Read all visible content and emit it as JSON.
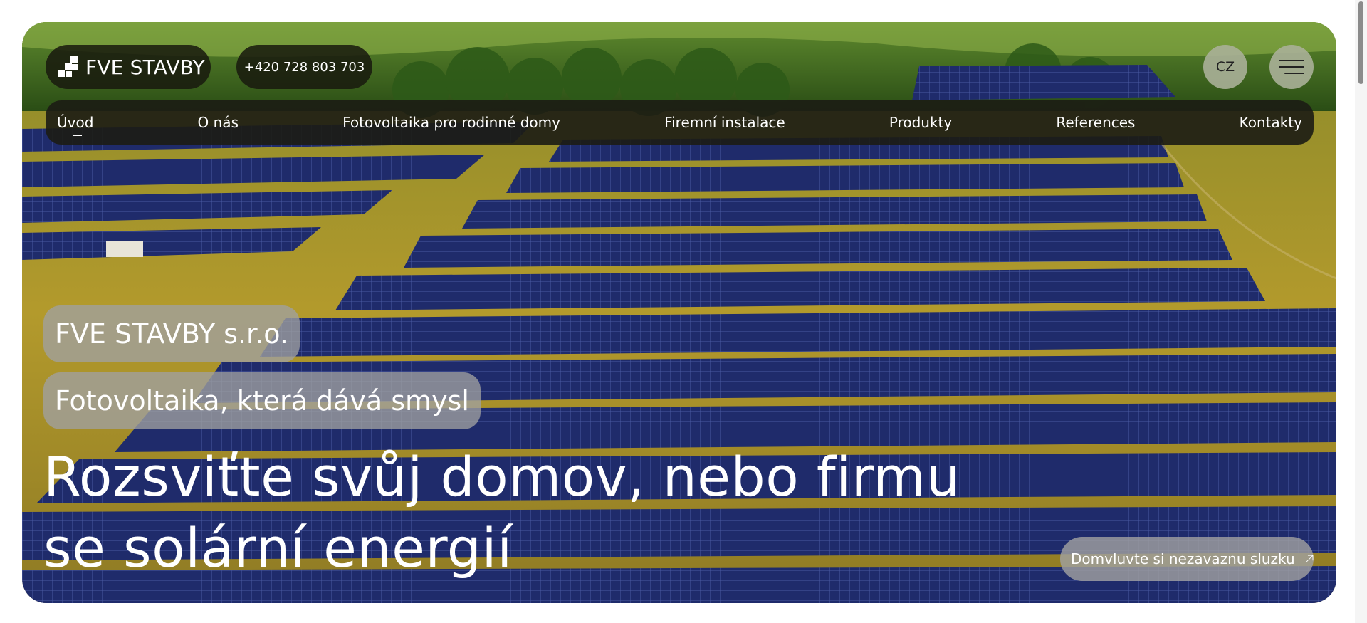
{
  "header": {
    "logo_text": "FVE STAVBY",
    "phone": "+420 728 803 703",
    "language": "CZ",
    "menu_icon": "hamburger-menu-icon"
  },
  "nav": {
    "items": [
      {
        "label": "Úvod",
        "active": true
      },
      {
        "label": "O nás"
      },
      {
        "label": "Fotovoltaika pro rodinné domy"
      },
      {
        "label": "Firemní instalace"
      },
      {
        "label": "Produkty"
      },
      {
        "label": "References"
      },
      {
        "label": "Kontakty"
      }
    ]
  },
  "hero": {
    "company_name": "FVE STAVBY s.r.o.",
    "slogan": "Fotovoltaika, která dává smysl",
    "headline_line1": "Rozsviťte svůj domov, nebo firmu",
    "headline_line2": "se solární energií",
    "cta_label": "Domvluvte si nezavaznu sluzku",
    "cta_icon": "arrow-up-right-icon"
  },
  "colors": {
    "pill_dark": "#181a0e",
    "pill_gray": "#a0a0a0",
    "panel_blue": "#202c6a",
    "grass": "#a8962e",
    "trees": "#2f5a1a"
  }
}
